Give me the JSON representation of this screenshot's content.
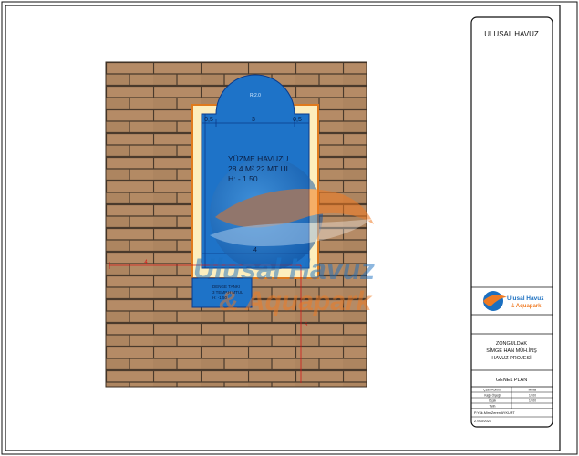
{
  "title_block": {
    "brand_header": "ULUSAL HAVUZ",
    "logo": {
      "line1": "Ulusal Havuz",
      "line2": "& Aquapark",
      "fine_print": [
        "",
        "",
        "",
        ""
      ]
    },
    "project": {
      "line1": "ZONGULDAK",
      "line2": "SİMGE HAN MÜH.İNŞ",
      "line3": "HAVUZ PROJESİ"
    },
    "sheet_name": "GENEL PLAN",
    "info_rows": [
      {
        "label": "Çizen/Kontrol",
        "value": "Mimar"
      },
      {
        "label": "Kağıt Ölçeği",
        "value": "1/100"
      },
      {
        "label": "Ölçek",
        "value": "1/100"
      },
      {
        "label": "Tarih",
        "value": ""
      }
    ],
    "revision": "P.Yük.Mim.Zeren AYKURT",
    "date": "27/09/2021"
  },
  "plan": {
    "pool_name": "YÜZME HAVUZU",
    "pool_area": "28.4 M² 22 MT UL",
    "pool_depth": "H: - 1.50",
    "semicircle_label": "R:2.0",
    "balance_tank": {
      "line1": "DENGE TANKI",
      "line2": "3 TEMP.H MTUL",
      "line3": "H: -1.50"
    },
    "dimensions": {
      "top_left": "0,5",
      "top_mid": "3",
      "top_right": "0,5",
      "bottom_mid": "4",
      "left_red": "4",
      "right_red": "5"
    },
    "watermark_line1": "Ulusal Havuz",
    "watermark_line2": "& Aquapark"
  },
  "colors": {
    "brick": "#b08863",
    "mortar": "#4a3a2c",
    "pool": "#1e73c8",
    "coping": "#fdeebd",
    "coping_edge": "#e07a1c",
    "dim_blue": "#0b3a8a",
    "dim_red": "#d41818",
    "logo_orange": "#f07a22",
    "logo_blue": "#1b6fc0"
  }
}
